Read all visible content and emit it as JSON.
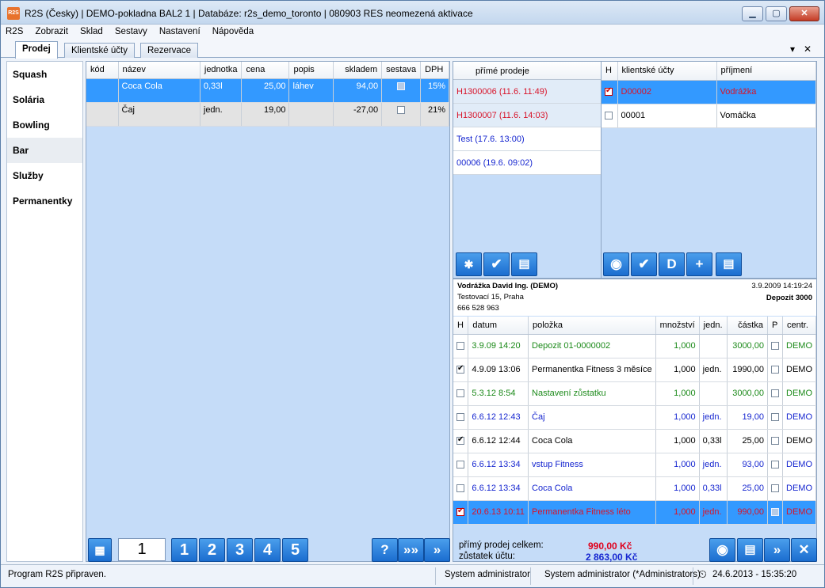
{
  "window": {
    "title": "R2S (Česky)  |  DEMO-pokladna BAL2 1  |  Databáze: r2s_demo_toronto  |  080903 RES neomezená aktivace",
    "app_icon": "R2S",
    "min": "▁",
    "max": "▢",
    "close": "✕"
  },
  "menu": [
    "R2S",
    "Zobrazit",
    "Sklad",
    "Sestavy",
    "Nastavení",
    "Nápověda"
  ],
  "tabs": [
    "Prodej",
    "Klientské účty",
    "Rezervace"
  ],
  "tab_controls": {
    "dropdown": "▾",
    "close": "✕"
  },
  "sidebar": [
    "Squash",
    "Solária",
    "Bowling",
    "Bar",
    "Služby",
    "Permanentky"
  ],
  "products": {
    "columns": [
      "kód",
      "název",
      "jednotka",
      "cena",
      "popis",
      "skladem",
      "sestava",
      "DPH"
    ],
    "rows": [
      {
        "kod": "",
        "nazev": "Coca Cola",
        "jednotka": "0,33l",
        "cena": "25,00",
        "popis": "láhev",
        "skladem": "94,00",
        "dph": "15%"
      },
      {
        "kod": "",
        "nazev": "Čaj",
        "jednotka": "jedn.",
        "cena": "19,00",
        "popis": "",
        "skladem": "-27,00",
        "dph": "21%"
      }
    ],
    "page_value": "1",
    "pages": [
      "1",
      "2",
      "3",
      "4",
      "5"
    ],
    "icons": {
      "grid": "grid-icon",
      "help": "?",
      "fast_forward": "»»",
      "next": "»"
    }
  },
  "direct_sales": {
    "header": "přímé prodeje",
    "items": [
      "H1300006 (11.6. 11:49)",
      "H1300007 (11.6. 14:03)",
      "Test (17.6. 13:00)",
      "00006 (19.6. 09:02)"
    ],
    "buttons": [
      "✱",
      "✔",
      "▤"
    ]
  },
  "client_accounts": {
    "columns": [
      "H",
      "klientské účty",
      "příjmení"
    ],
    "rows": [
      {
        "account": "D00002",
        "surname": "Vodrážka"
      },
      {
        "account": "00001",
        "surname": "Vomáčka"
      }
    ],
    "buttons": [
      "◉",
      "✔",
      "D",
      "+",
      "▤"
    ]
  },
  "client_detail": {
    "name": "Vodrážka David Ing. (DEMO)",
    "date": "3.9.2009 14:19:24",
    "street": "Testovací 15, Praha",
    "deposit": "Depozit 3000",
    "phone": "666 528 963"
  },
  "transactions": {
    "columns": [
      "H",
      "datum",
      "položka",
      "množství",
      "jedn.",
      "částka",
      "P",
      "centr."
    ],
    "rows": [
      {
        "datum": "3.9.09 14:20",
        "polozka": "Depozit 01-0000002",
        "mnozstvi": "1,000",
        "jedn": "",
        "castka": "3000,00",
        "centr": "DEMO"
      },
      {
        "datum": "4.9.09 13:06",
        "polozka": "Permanentka Fitness 3 měsíce",
        "mnozstvi": "1,000",
        "jedn": "jedn.",
        "castka": "1990,00",
        "centr": "DEMO"
      },
      {
        "datum": "5.3.12 8:54",
        "polozka": "Nastavení zůstatku",
        "mnozstvi": "1,000",
        "jedn": "",
        "castka": "3000,00",
        "centr": "DEMO"
      },
      {
        "datum": "6.6.12 12:43",
        "polozka": "Čaj",
        "mnozstvi": "1,000",
        "jedn": "jedn.",
        "castka": "19,00",
        "centr": "DEMO"
      },
      {
        "datum": "6.6.12 12:44",
        "polozka": "Coca Cola",
        "mnozstvi": "1,000",
        "jedn": "0,33l",
        "castka": "25,00",
        "centr": "DEMO"
      },
      {
        "datum": "6.6.12 13:34",
        "polozka": "vstup Fitness",
        "mnozstvi": "1,000",
        "jedn": "jedn.",
        "castka": "93,00",
        "centr": "DEMO"
      },
      {
        "datum": "6.6.12 13:34",
        "polozka": "Coca Cola",
        "mnozstvi": "1,000",
        "jedn": "0,33l",
        "castka": "25,00",
        "centr": "DEMO"
      },
      {
        "datum": "20.6.13 10:11",
        "polozka": "Permanentka Fitness léto",
        "mnozstvi": "1,000",
        "jedn": "jedn.",
        "castka": "990,00",
        "centr": "DEMO"
      }
    ],
    "totals": {
      "direct_label": "přímý prodej celkem:",
      "direct_value": "990,00 Kč",
      "balance_label": "zůstatek účtu:",
      "balance_value": "2 863,00 Kč"
    },
    "buttons": [
      "◉",
      "▤",
      "»",
      "✕"
    ]
  },
  "status": {
    "message": "Program R2S připraven.",
    "user": "System administrator",
    "role": "System administrator (*Administrators)",
    "datetime": "24.6.2013 - 15:35:20"
  }
}
